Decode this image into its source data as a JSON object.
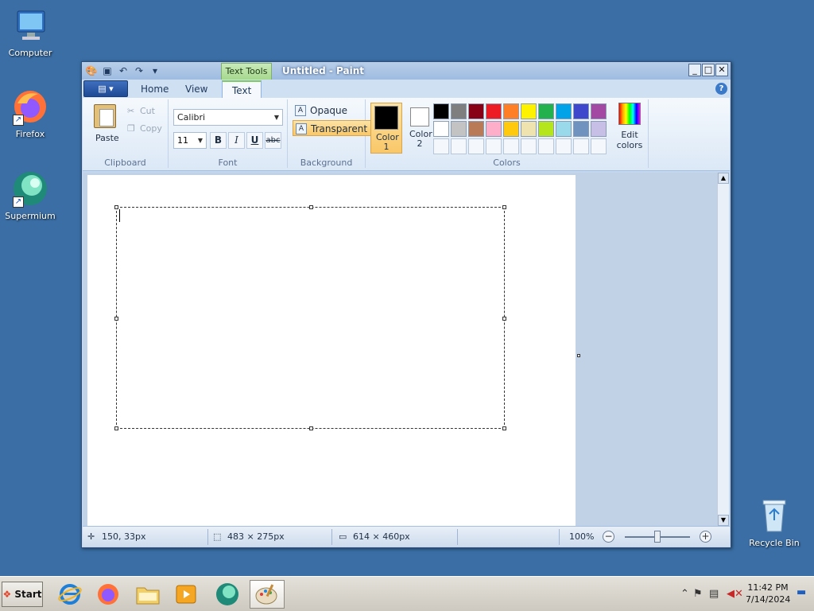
{
  "desktop": {
    "icons": [
      {
        "label": "Computer"
      },
      {
        "label": "Firefox"
      },
      {
        "label": "Supermium"
      },
      {
        "label": "Recycle Bin"
      }
    ]
  },
  "window": {
    "contextual_tab": "Text Tools",
    "title": "Untitled - Paint",
    "controls": {
      "minimize": "_",
      "maximize": "□",
      "close": "✕"
    },
    "app_menu_label": "▤ ▾",
    "tabs": [
      "Home",
      "View",
      "Text"
    ],
    "active_tab": "Text",
    "help": "?"
  },
  "ribbon": {
    "clipboard": {
      "label": "Clipboard",
      "paste": "Paste",
      "cut": "Cut",
      "copy": "Copy"
    },
    "font": {
      "label": "Font",
      "family": "Calibri",
      "size": "11",
      "bold": "B",
      "italic": "I",
      "underline": "U",
      "strike": "abc"
    },
    "background": {
      "label": "Background",
      "opaque": "Opaque",
      "transparent": "Transparent",
      "selected": "Transparent"
    },
    "colors": {
      "label": "Colors",
      "color1_label": "Color 1",
      "color1_value": "#000000",
      "color2_label": "Color 2",
      "color2_value": "#ffffff",
      "edit_colors": "Edit colors",
      "palette": [
        "#000000",
        "#7f7f7f",
        "#880015",
        "#ed1c24",
        "#ff7f27",
        "#fff200",
        "#22b14c",
        "#00a2e8",
        "#3f48cc",
        "#a349a4",
        "#ffffff",
        "#c3c3c3",
        "#b97a57",
        "#ffaec9",
        "#ffc90e",
        "#efe4b0",
        "#b5e61d",
        "#99d9ea",
        "#7092be",
        "#c8bfe7",
        "#ffffff",
        "#ffffff",
        "#ffffff",
        "#ffffff",
        "#ffffff",
        "#ffffff",
        "#ffffff",
        "#ffffff",
        "#ffffff",
        "#ffffff"
      ]
    }
  },
  "status": {
    "cursor_pos": "150, 33px",
    "selection_size": "483 × 275px",
    "image_size": "614 × 460px",
    "zoom": "100%"
  },
  "taskbar": {
    "start": "Start",
    "apps": [
      "Internet Explorer",
      "Firefox",
      "File Explorer",
      "Media Player",
      "Supermium",
      "Paint"
    ],
    "time": "11:42 PM",
    "date": "7/14/2024"
  }
}
